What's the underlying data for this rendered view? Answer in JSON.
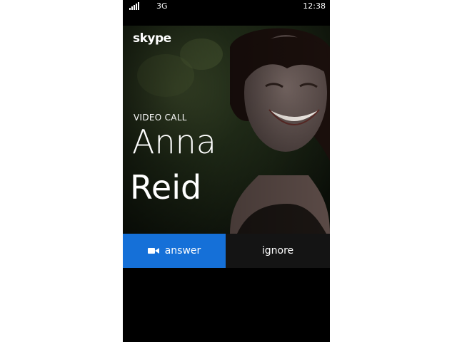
{
  "status_bar": {
    "network": "3G",
    "time": "12:38",
    "signal_bars": 5
  },
  "call": {
    "app_logo": "skype",
    "type_label": "VIDEO CALL",
    "caller_first_name": "Anna",
    "caller_last_name": "Reid"
  },
  "actions": {
    "answer_label": "answer",
    "answer_icon": "video-camera-icon",
    "ignore_label": "ignore"
  },
  "colors": {
    "accent": "#1570d8",
    "background": "#000000",
    "secondary_button": "#141414"
  }
}
